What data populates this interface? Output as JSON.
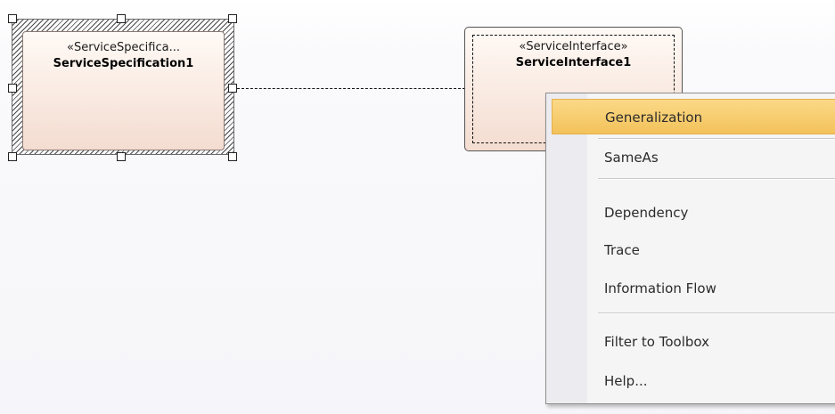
{
  "diagram": {
    "selected_element": {
      "stereotype": "«ServiceSpecifica...",
      "name": "ServiceSpecification1"
    },
    "target_element": {
      "stereotype": "«ServiceInterface»",
      "name": "ServiceInterface1"
    }
  },
  "context_menu": {
    "items": [
      {
        "label": "Generalization",
        "highlighted": true
      },
      {
        "label": "SameAs"
      },
      {
        "label": "Dependency"
      },
      {
        "label": "Trace"
      },
      {
        "label": "Information Flow"
      },
      {
        "label": "Filter to Toolbox"
      },
      {
        "label": "Help..."
      }
    ]
  },
  "colors": {
    "highlight": "#f3c25a",
    "element_fill": "#f4dcd0"
  }
}
